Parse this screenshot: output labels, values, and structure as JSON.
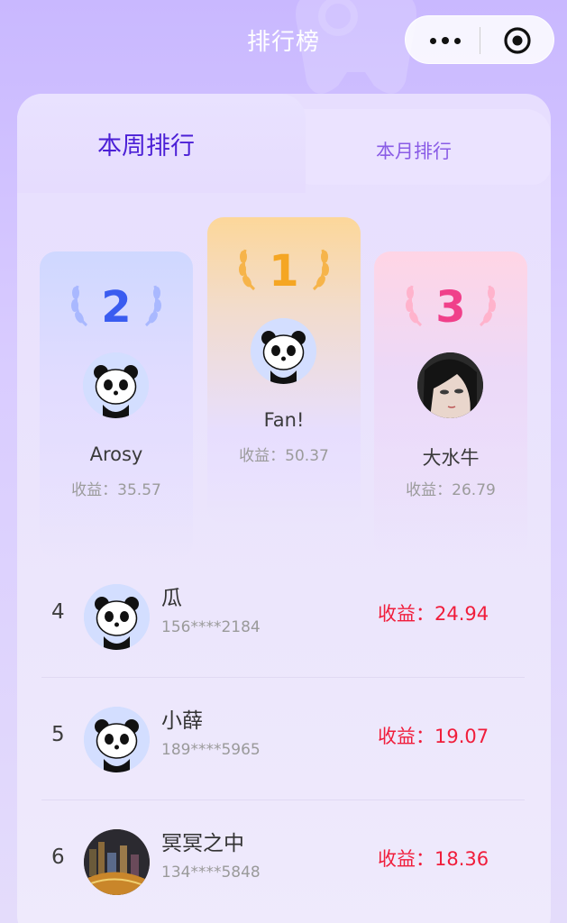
{
  "header": {
    "title": "排行榜"
  },
  "tabs": [
    {
      "label": "本周排行",
      "active": true
    },
    {
      "label": "本月排行",
      "active": false
    }
  ],
  "podium": [
    {
      "rank": "2",
      "name": "Arosy",
      "income": "收益：35.57",
      "avatar": "panda"
    },
    {
      "rank": "1",
      "name": "Fan!",
      "income": "收益：50.37",
      "avatar": "panda"
    },
    {
      "rank": "3",
      "name": "大水牛",
      "income": "收益：26.79",
      "avatar": "anime-girl"
    }
  ],
  "list": [
    {
      "rank": "4",
      "name": "瓜",
      "phone": "156****2184",
      "income": "收益：24.94",
      "avatar": "panda"
    },
    {
      "rank": "5",
      "name": "小薛",
      "phone": "189****5965",
      "income": "收益：19.07",
      "avatar": "panda"
    },
    {
      "rank": "6",
      "name": "冥冥之中",
      "phone": "134****5848",
      "income": "收益：18.36",
      "avatar": "city-night"
    }
  ],
  "colors": {
    "accent": "#4b1fd6",
    "income_red": "#f01d3b",
    "gold": "#f5a623",
    "silver_blue": "#3a5cf0",
    "bronze_pink": "#f0408a"
  }
}
